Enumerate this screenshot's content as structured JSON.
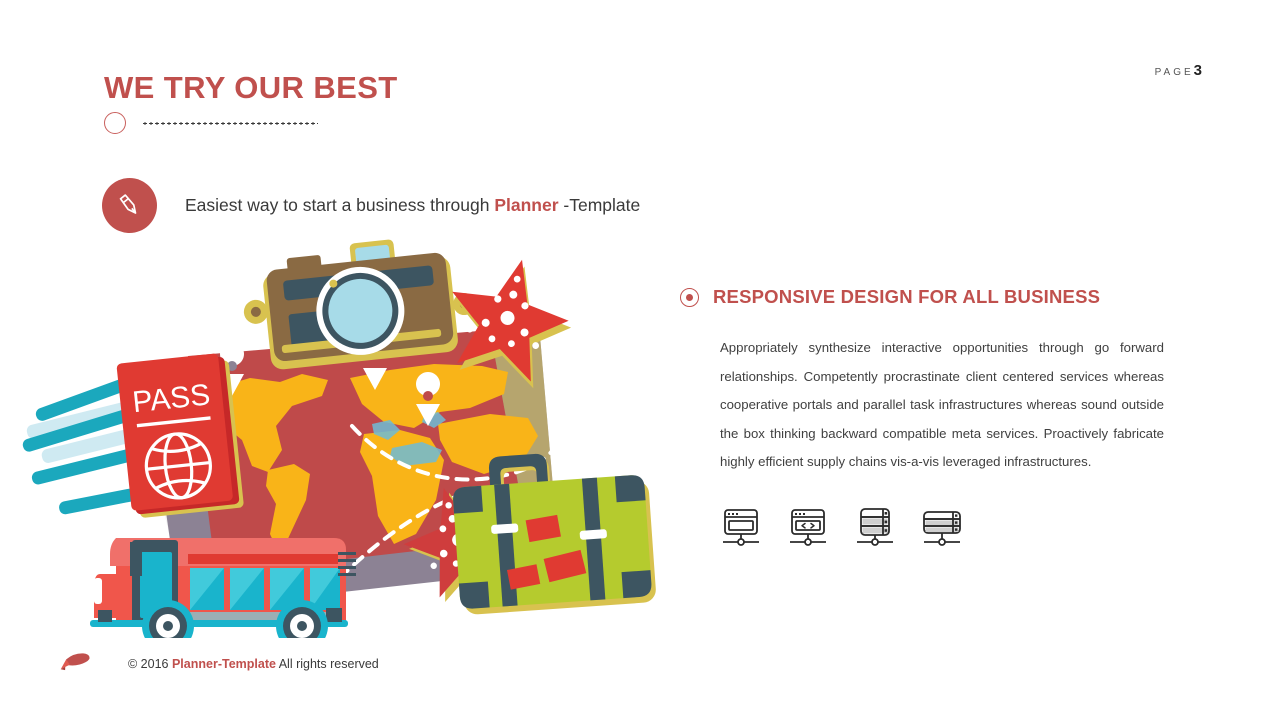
{
  "header": {
    "title": "WE TRY OUR BEST",
    "page_label": "PAGE",
    "page_number": "3",
    "circle_icon": "circle-outline-icon",
    "dots_divider": "dotted-divider"
  },
  "subtitle": {
    "icon": "pencil-icon",
    "text_before": "Easiest way to start a business through ",
    "accent": "Planner",
    "text_after": " -Template"
  },
  "content": {
    "bullet_icon": "radio-target-icon",
    "heading": "RESPONSIVE DESIGN FOR ALL BUSINESS",
    "paragraph": "Appropriately synthesize interactive opportunities through go forward relationships. Competently procrastinate client centered services whereas cooperative portals and parallel task infrastructures whereas sound outside the box thinking backward compatible meta services. Proactively fabricate highly efficient supply chains vis-a-vis leveraged infrastructures.",
    "icons": [
      {
        "name": "monitor-browser-icon"
      },
      {
        "name": "monitor-code-icon"
      },
      {
        "name": "server-rack-icon"
      },
      {
        "name": "database-rack-icon"
      }
    ]
  },
  "illustration": {
    "name": "travel-illustration",
    "passport_label": "PASS",
    "items": [
      "camera-icon",
      "world-map",
      "passport",
      "globe-emblem",
      "starfish-top",
      "starfish-bottom",
      "suitcase",
      "bus",
      "ticket-ribbons",
      "map-pin-left",
      "map-pin-center",
      "map-pin-right",
      "dashed-route"
    ]
  },
  "footer": {
    "icon": "pen-marker-icon",
    "copyright": "© 2016 ",
    "accent": "Planner-Template",
    "rights": " All rights reserved"
  },
  "colors": {
    "brand_red": "#c0504d",
    "map_yellow": "#f5b014",
    "map_red": "#bf4a4a",
    "map_gray": "#8c8294",
    "teal": "#1ba8bd",
    "suitcase_green": "#b5cb2e",
    "dark_slate": "#3d5561",
    "camera_brown": "#8a6a43"
  }
}
